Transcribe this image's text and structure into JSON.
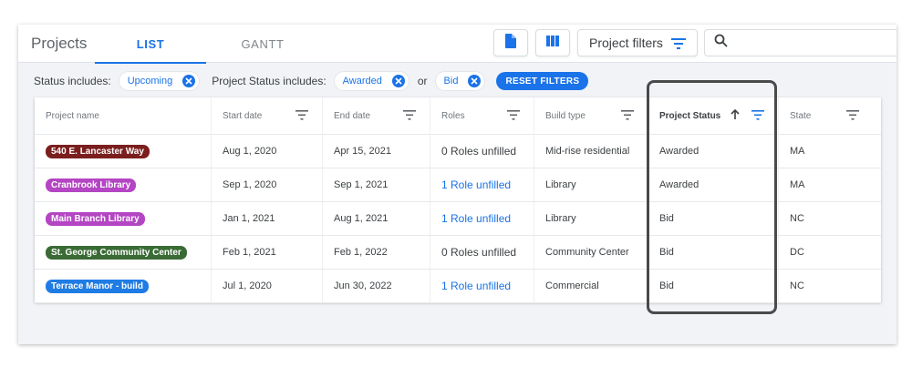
{
  "app": {
    "title": "Projects"
  },
  "tabs": [
    {
      "label": "LIST",
      "active": true
    },
    {
      "label": "GANTT",
      "active": false
    }
  ],
  "toolbar": {
    "doc_icon": "document-icon",
    "columns_icon": "columns-icon",
    "filters_label": "Project filters",
    "search_placeholder": ""
  },
  "filters": {
    "status_label": "Status includes:",
    "status_chip": "Upcoming",
    "project_status_label": "Project Status includes:",
    "project_status_chips": [
      "Awarded",
      "Bid"
    ],
    "or_label": "or",
    "reset_label": "RESET FILTERS"
  },
  "table": {
    "columns": [
      "Project name",
      "Start date",
      "End date",
      "Roles",
      "Build type",
      "Project Status",
      "State"
    ],
    "rows": [
      {
        "name": "540 E. Lancaster Way",
        "color": "#7b1e1e",
        "start": "Aug 1, 2020",
        "end": "Apr 15, 2021",
        "roles": "0 Roles unfilled",
        "roles_link": false,
        "build": "Mid-rise residential",
        "status": "Awarded",
        "state": "MA"
      },
      {
        "name": "Cranbrook Library",
        "color": "#b445c3",
        "start": "Sep 1, 2020",
        "end": "Sep 1, 2021",
        "roles": "1 Role unfilled",
        "roles_link": true,
        "build": "Library",
        "status": "Awarded",
        "state": "MA"
      },
      {
        "name": "Main Branch Library",
        "color": "#b445c3",
        "start": "Jan 1, 2021",
        "end": "Aug 1, 2021",
        "roles": "1 Role unfilled",
        "roles_link": true,
        "build": "Library",
        "status": "Bid",
        "state": "NC"
      },
      {
        "name": "St. George Community Center",
        "color": "#3a6b35",
        "start": "Feb 1, 2021",
        "end": "Feb 1, 2022",
        "roles": "0 Roles unfilled",
        "roles_link": false,
        "build": "Community Center",
        "status": "Bid",
        "state": "DC"
      },
      {
        "name": "Terrace Manor - build",
        "color": "#1e7ce4",
        "start": "Jul 1, 2020",
        "end": "Jun 30, 2022",
        "roles": "1 Role unfilled",
        "roles_link": true,
        "build": "Commercial",
        "status": "Bid",
        "state": "NC"
      }
    ]
  },
  "colors": {
    "accent": "#1a73e8",
    "highlight_border": "#4a4a4a"
  }
}
